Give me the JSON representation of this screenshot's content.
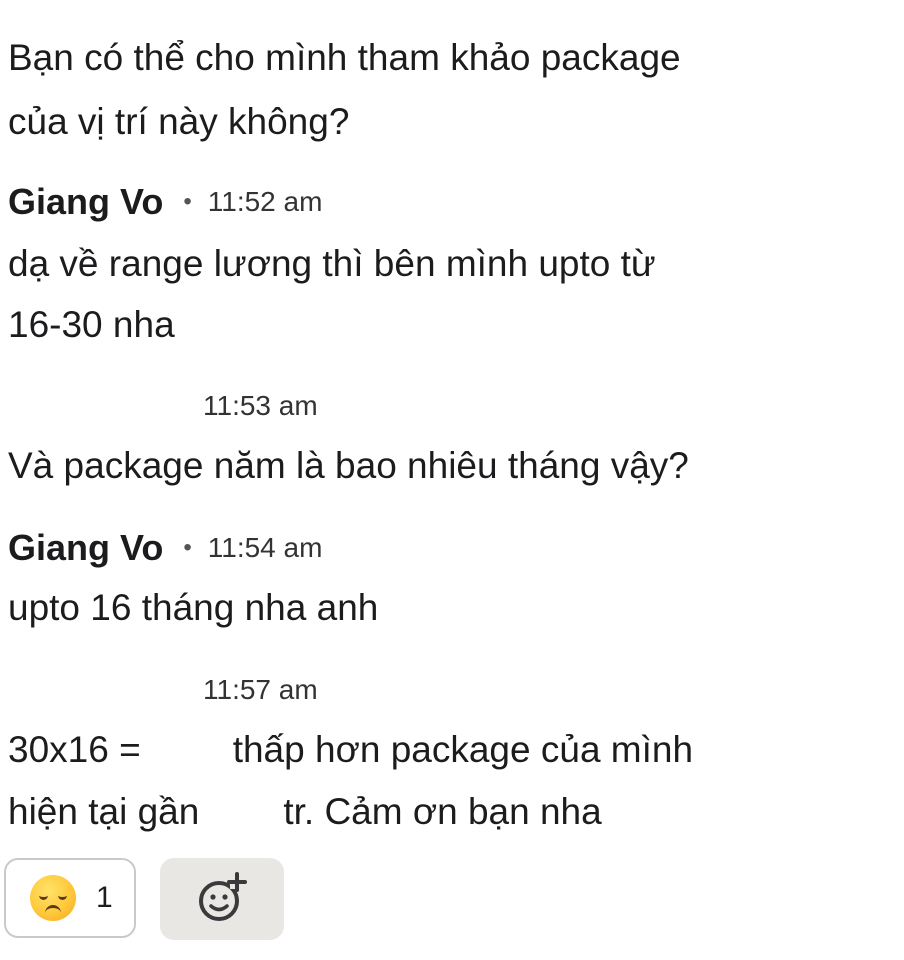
{
  "messages": {
    "m1_line1": "Bạn có thể cho mình tham khảo package",
    "m1_line2": "của vị trí này không?",
    "h1_sender": "Giang Vo",
    "h1_dot": "•",
    "h1_time": "11:52 am",
    "m2_line1": "dạ về range lương thì bên mình upto từ",
    "m2_line2": "16-30 nha",
    "t2_time": "11:53 am",
    "m3_line1": "Và package năm là bao nhiêu tháng vậy?",
    "h2_sender": "Giang Vo",
    "h2_dot": "•",
    "h2_time": "11:54 am",
    "m4_line1": "upto 16  tháng nha anh",
    "t3_time": "11:57 am",
    "m5_line1_a": "30x16 =",
    "m5_line1_b": "thấp hơn package của mình",
    "m5_line2_a": "hiện tại gần",
    "m5_line2_b": "tr. Cảm ơn bạn nha"
  },
  "reactions": {
    "emoji": "disappointed-face-emoji",
    "count": "1",
    "add_icon": "add-reaction-icon"
  }
}
